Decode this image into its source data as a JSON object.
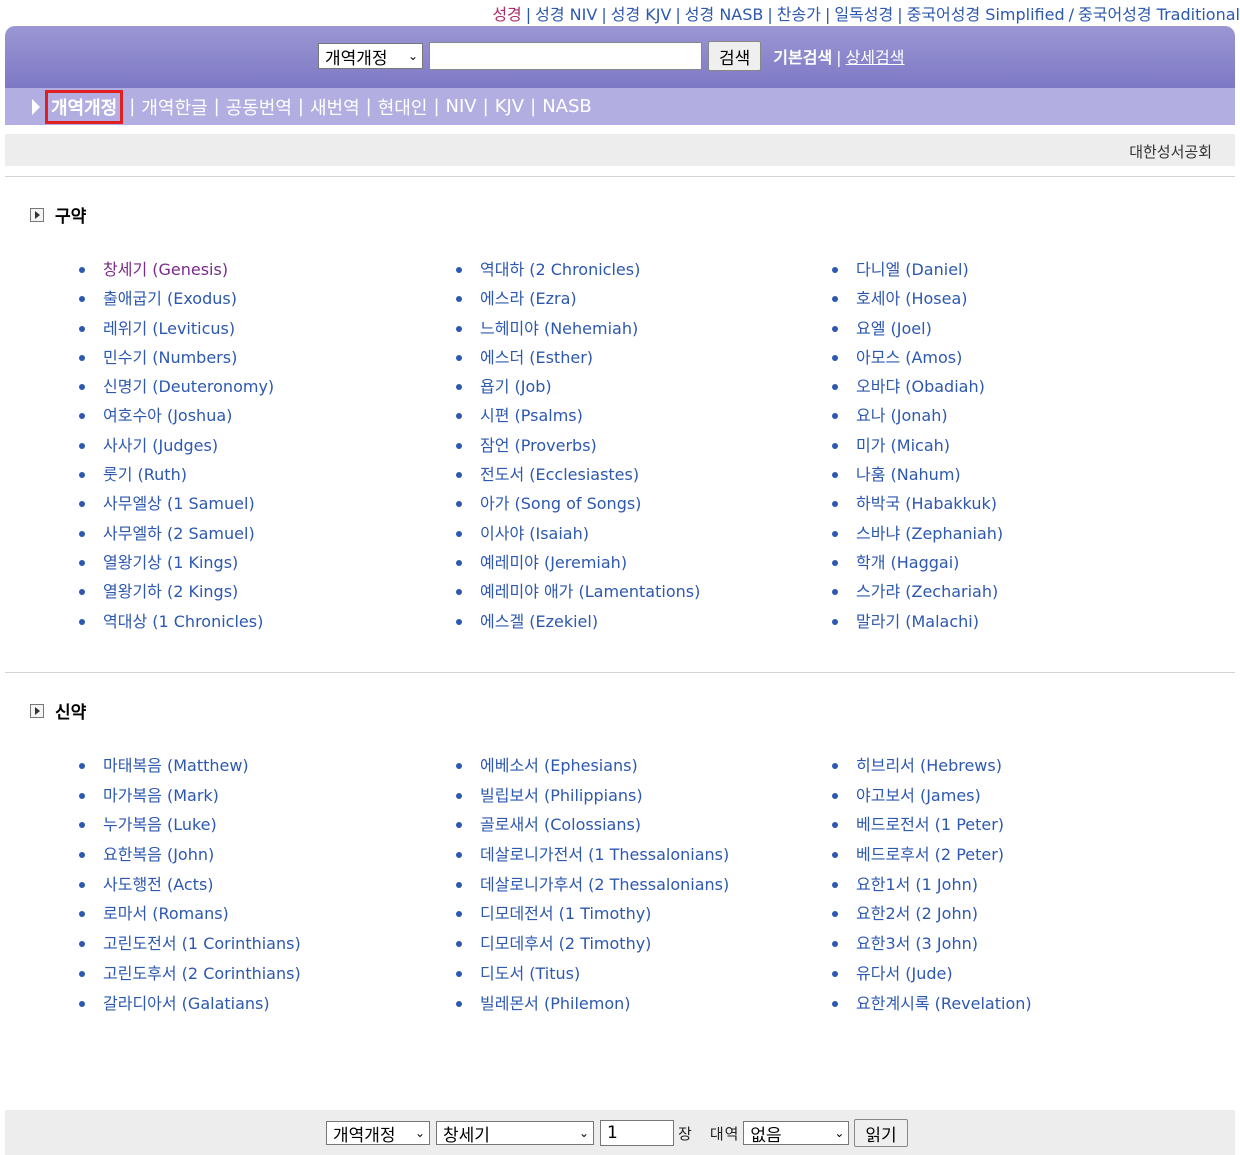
{
  "top_links": [
    "성경",
    "성경 NIV",
    "성경 KJV",
    "성경 NASB",
    "찬송가",
    "일독성경",
    "중국어성경 Simplified",
    "중국어성경 Traditional"
  ],
  "top_links_sep": "|",
  "top_links_sep_slash": "/",
  "search": {
    "version_select": "개역개정",
    "input_value": "",
    "button": "검색",
    "basic_mode": "기본검색",
    "detail_mode": "상세검색",
    "sep": "|"
  },
  "versions": {
    "active": "개역개정",
    "items": [
      "개역한글",
      "공동번역",
      "새번역",
      "현대인",
      "NIV",
      "KJV",
      "NASB"
    ],
    "sep": "|"
  },
  "society": "대한성서공회",
  "old_testament": {
    "title": "구약",
    "columns": [
      [
        "창세기 (Genesis)",
        "출애굽기 (Exodus)",
        "레위기 (Leviticus)",
        "민수기 (Numbers)",
        "신명기 (Deuteronomy)",
        "여호수아 (Joshua)",
        "사사기 (Judges)",
        "룻기 (Ruth)",
        "사무엘상 (1 Samuel)",
        "사무엘하 (2 Samuel)",
        "열왕기상 (1 Kings)",
        "열왕기하 (2 Kings)",
        "역대상 (1 Chronicles)"
      ],
      [
        "역대하 (2 Chronicles)",
        "에스라 (Ezra)",
        "느헤미야 (Nehemiah)",
        "에스더 (Esther)",
        "욥기 (Job)",
        "시편 (Psalms)",
        "잠언 (Proverbs)",
        "전도서 (Ecclesiastes)",
        "아가 (Song of Songs)",
        "이사야 (Isaiah)",
        "예레미야 (Jeremiah)",
        "예레미야 애가 (Lamentations)",
        "에스겔 (Ezekiel)"
      ],
      [
        "다니엘 (Daniel)",
        "호세아 (Hosea)",
        "요엘 (Joel)",
        "아모스 (Amos)",
        "오바댜 (Obadiah)",
        "요나 (Jonah)",
        "미가 (Micah)",
        "나훔 (Nahum)",
        "하박국 (Habakkuk)",
        "스바냐 (Zephaniah)",
        "학개 (Haggai)",
        "스가랴 (Zechariah)",
        "말라기 (Malachi)"
      ]
    ]
  },
  "new_testament": {
    "title": "신약",
    "columns": [
      [
        "마태복음 (Matthew)",
        "마가복음 (Mark)",
        "누가복음 (Luke)",
        "요한복음 (John)",
        "사도행전 (Acts)",
        "로마서 (Romans)",
        "고린도전서 (1 Corinthians)",
        "고린도후서 (2 Corinthians)",
        "갈라디아서 (Galatians)"
      ],
      [
        "에베소서 (Ephesians)",
        "빌립보서 (Philippians)",
        "골로새서 (Colossians)",
        "데살로니가전서 (1 Thessalonians)",
        "데살로니가후서 (2 Thessalonians)",
        "디모데전서 (1 Timothy)",
        "디모데후서 (2 Timothy)",
        "디도서 (Titus)",
        "빌레몬서 (Philemon)"
      ],
      [
        "히브리서 (Hebrews)",
        "야고보서 (James)",
        "베드로전서 (1 Peter)",
        "베드로후서 (2 Peter)",
        "요한1서 (1 John)",
        "요한2서 (2 John)",
        "요한3서 (3 John)",
        "유다서 (Jude)",
        "요한계시록 (Revelation)"
      ]
    ]
  },
  "reader": {
    "version_select": "개역개정",
    "book_select": "창세기",
    "chapter_value": "1",
    "chapter_unit": "장",
    "parallel_label": "대역",
    "parallel_select": "없음",
    "read_button": "읽기"
  },
  "colors": {
    "link": "#2d58b0",
    "visited_link": "#7a2a8a",
    "header_purple": "#8a85cc",
    "version_bar": "#b3aee2",
    "active_highlight": "#e02020"
  }
}
